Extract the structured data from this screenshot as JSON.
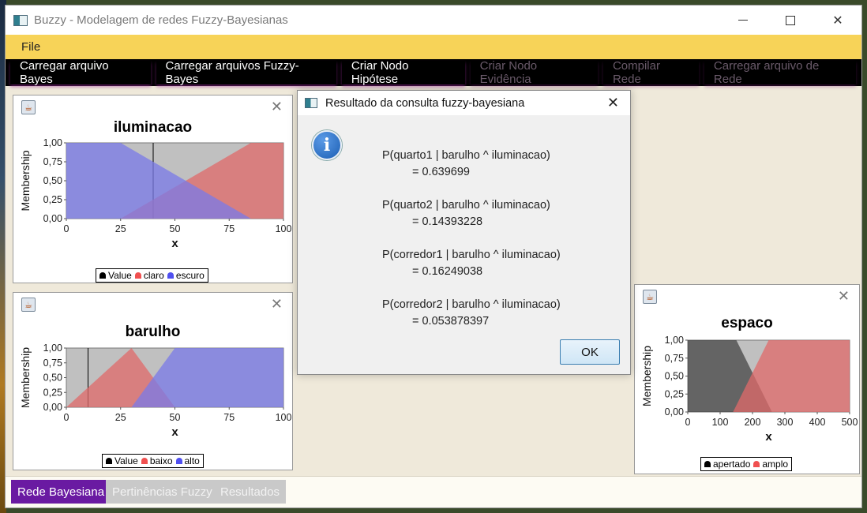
{
  "window": {
    "title": "Buzzy - Modelagem de redes Fuzzy-Bayesianas"
  },
  "menu": {
    "file": "File"
  },
  "toolbar": {
    "buttons": [
      "Carregar arquivo Bayes",
      "Carregar arquivos Fuzzy-Bayes",
      "Criar Nodo Hipótese",
      "Criar Nodo Evidência",
      "Compilar Rede",
      "Carregar arquivo de Rede"
    ]
  },
  "colors": {
    "accent_yellow": "#f7d358",
    "tab_active": "#6a1aa2",
    "series_red": "#e06a6a",
    "series_blue": "#7a7ae8",
    "series_black": "#333333",
    "plot_bg": "#c0c0c0"
  },
  "frames": {
    "iluminacao": {
      "title": "iluminacao",
      "ylabel": "Membership",
      "xlabel": "x",
      "legend": [
        "Value",
        "claro",
        "escuro"
      ]
    },
    "barulho": {
      "title": "barulho",
      "ylabel": "Membership",
      "xlabel": "x",
      "legend": [
        "Value",
        "baixo",
        "alto"
      ]
    },
    "espaco": {
      "title": "espaco",
      "ylabel": "Membership",
      "xlabel": "x",
      "legend": [
        "apertado",
        "amplo"
      ]
    }
  },
  "chart_data": [
    {
      "type": "area",
      "title": "iluminacao",
      "xlabel": "x",
      "ylabel": "Membership",
      "xlim": [
        0,
        100
      ],
      "ylim": [
        0,
        1
      ],
      "x_ticks": [
        "0",
        "25",
        "50",
        "75",
        "100"
      ],
      "y_ticks": [
        "0,00",
        "0,25",
        "0,50",
        "0,75",
        "1,00"
      ],
      "series": [
        {
          "name": "Value",
          "kind": "vline",
          "x": 40
        },
        {
          "name": "claro",
          "points": [
            [
              25,
              0
            ],
            [
              85,
              1
            ],
            [
              100,
              1
            ],
            [
              100,
              0
            ]
          ]
        },
        {
          "name": "escuro",
          "points": [
            [
              0,
              0
            ],
            [
              0,
              1
            ],
            [
              25,
              1
            ],
            [
              85,
              0
            ]
          ]
        }
      ],
      "legend_position": "bottom"
    },
    {
      "type": "area",
      "title": "barulho",
      "xlabel": "x",
      "ylabel": "Membership",
      "xlim": [
        0,
        100
      ],
      "ylim": [
        0,
        1
      ],
      "x_ticks": [
        "0",
        "25",
        "50",
        "75",
        "100"
      ],
      "y_ticks": [
        "0,00",
        "0,25",
        "0,50",
        "0,75",
        "1,00"
      ],
      "series": [
        {
          "name": "Value",
          "kind": "vline",
          "x": 10
        },
        {
          "name": "baixo",
          "points": [
            [
              0,
              0
            ],
            [
              30,
              1
            ],
            [
              50,
              0
            ]
          ]
        },
        {
          "name": "alto",
          "points": [
            [
              30,
              0
            ],
            [
              50,
              1
            ],
            [
              100,
              1
            ],
            [
              100,
              0
            ]
          ]
        }
      ],
      "legend_position": "bottom"
    },
    {
      "type": "area",
      "title": "espaco",
      "xlabel": "x",
      "ylabel": "Membership",
      "xlim": [
        0,
        500
      ],
      "ylim": [
        0,
        1
      ],
      "x_ticks": [
        "0",
        "100",
        "200",
        "300",
        "400",
        "500"
      ],
      "y_ticks": [
        "0,00",
        "0,25",
        "0,50",
        "0,75",
        "1,00"
      ],
      "series": [
        {
          "name": "apertado",
          "points": [
            [
              0,
              0
            ],
            [
              0,
              1
            ],
            [
              150,
              1
            ],
            [
              260,
              0
            ]
          ]
        },
        {
          "name": "amplo",
          "points": [
            [
              140,
              0
            ],
            [
              250,
              1
            ],
            [
              500,
              1
            ],
            [
              500,
              0
            ]
          ]
        }
      ],
      "legend_position": "bottom"
    }
  ],
  "dialog": {
    "title": "Resultado da consulta fuzzy-bayesiana",
    "results": [
      {
        "query": "P(quarto1 | barulho ^ iluminacao)",
        "value": "= 0.639699"
      },
      {
        "query": "P(quarto2 | barulho ^ iluminacao)",
        "value": "= 0.14393228"
      },
      {
        "query": "P(corredor1 | barulho ^ iluminacao)",
        "value": "= 0.16249038"
      },
      {
        "query": "P(corredor2 | barulho ^ iluminacao)",
        "value": "= 0.053878397"
      }
    ],
    "ok_label": "OK"
  },
  "tabs": [
    "Rede Bayesiana",
    "Pertinências Fuzzy",
    "Resultados"
  ]
}
